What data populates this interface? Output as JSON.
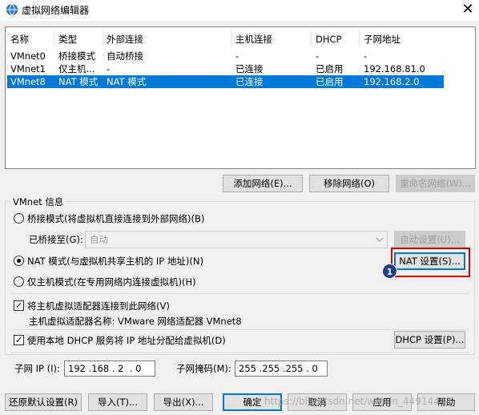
{
  "window": {
    "title": "虚拟网络编辑器",
    "close_glyph": "✕"
  },
  "table": {
    "headers": [
      "名称",
      "类型",
      "外部连接",
      "主机连接",
      "DHCP",
      "子网地址"
    ],
    "rows": [
      [
        "VMnet0",
        "桥接模式",
        "自动桥接",
        "-",
        "-",
        "-"
      ],
      [
        "VMnet1",
        "仅主机...",
        "-",
        "已连接",
        "已启用",
        "192.168.81.0"
      ],
      [
        "VMnet8",
        "NAT 模式",
        "NAT 模式",
        "已连接",
        "已启用",
        "192.168.2.0"
      ]
    ],
    "selected_row": 2
  },
  "table_buttons": {
    "add": "添加网络(E)...",
    "remove": "移除网络(O)",
    "rename": "重命名网络(W)..."
  },
  "info": {
    "group_label": "VMnet 信息",
    "bridge_label": "桥接模式(将虚拟机直接连接到外部网络)(B)",
    "bridged_to_label": "已桥接至(G):",
    "bridged_to_value": "自动",
    "auto_settings": "自动设置(U)...",
    "nat_label": "NAT 模式(与虚拟机共享主机的 IP 地址)(N)",
    "nat_settings": "NAT 设置(S)...",
    "hostonly_label": "仅主机模式(在专用网络内连接虚拟机)(H)",
    "connect_adapter_label": "将主机虚拟适配器连接到此网络(V)",
    "adapter_name_text": "主机虚拟适配器名称: VMware 网络适配器 VMnet8",
    "dhcp_label": "使用本地 DHCP 服务将 IP 地址分配给虚拟机(D)",
    "dhcp_settings": "DHCP 设置(P)...",
    "subnet_ip_label": "子网 IP (I):",
    "subnet_ip_value": "192 .168 . 2  . 0",
    "subnet_mask_label": "子网掩码(M):",
    "subnet_mask_value": "255 .255 .255 . 0",
    "selected_mode": "nat",
    "connect_adapter_checked": true,
    "dhcp_checked": true
  },
  "annotation": {
    "badge": "1"
  },
  "bottom_buttons": {
    "restore": "还原默认设置(R)",
    "import": "导入(T)...",
    "export": "导出(X)...",
    "ok": "确定",
    "cancel": "取消",
    "apply": "应用",
    "help": "帮助"
  },
  "watermark": "https://blog.csdn.net/weixin_44914444",
  "colors": {
    "selection": "#0078d7",
    "callout": "#e00000",
    "badge": "#1b3d8f"
  }
}
